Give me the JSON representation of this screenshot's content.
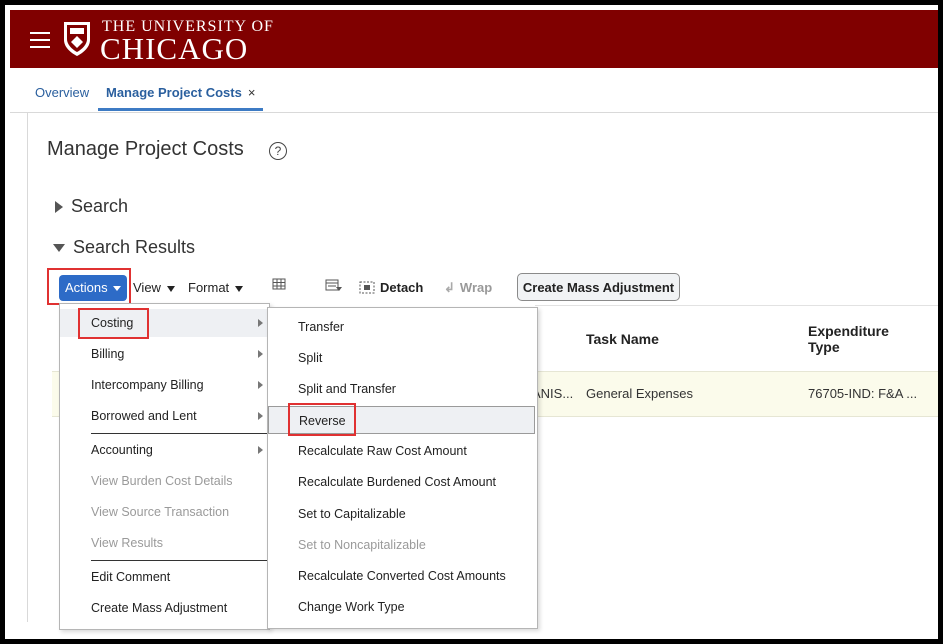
{
  "brand": {
    "top": "THE UNIVERSITY OF",
    "main": "CHICAGO"
  },
  "tabs": {
    "overview": "Overview",
    "active": "Manage Project Costs",
    "close": "×"
  },
  "page": {
    "title": "Manage Project Costs",
    "help": "?"
  },
  "sections": {
    "search": "Search",
    "results": "Search Results"
  },
  "toolbar": {
    "actions": "Actions",
    "view": "View",
    "format": "Format",
    "detach": "Detach",
    "wrap": "Wrap",
    "mass_adjustment": "Create Mass Adjustment"
  },
  "table": {
    "headers": {
      "task_name": "Task Name",
      "exp_type_1": "Expenditure",
      "exp_type_2": "Type"
    },
    "row": {
      "project_frag": "ANIS...",
      "task_name": "General Expenses",
      "exp_type": "76705-IND: F&A ..."
    }
  },
  "actions_menu": [
    {
      "label": "Costing",
      "submenu": true,
      "enabled": true
    },
    {
      "label": "Billing",
      "submenu": true,
      "enabled": true
    },
    {
      "label": "Intercompany Billing",
      "submenu": true,
      "enabled": true
    },
    {
      "label": "Borrowed and Lent",
      "submenu": true,
      "enabled": true
    },
    {
      "label": "Accounting",
      "submenu": true,
      "enabled": true
    },
    {
      "label": "View Burden Cost Details",
      "submenu": false,
      "enabled": false
    },
    {
      "label": "View Source Transaction",
      "submenu": false,
      "enabled": false
    },
    {
      "label": "View Results",
      "submenu": false,
      "enabled": false
    },
    {
      "label": "Edit Comment",
      "submenu": false,
      "enabled": true
    },
    {
      "label": "Create Mass Adjustment",
      "submenu": false,
      "enabled": true
    }
  ],
  "costing_menu": [
    {
      "label": "Transfer",
      "enabled": true
    },
    {
      "label": "Split",
      "enabled": true
    },
    {
      "label": "Split and Transfer",
      "enabled": true
    },
    {
      "label": "Reverse",
      "enabled": true
    },
    {
      "label": "Recalculate Raw Cost Amount",
      "enabled": true
    },
    {
      "label": "Recalculate Burdened Cost Amount",
      "enabled": true
    },
    {
      "label": "Set to Capitalizable",
      "enabled": true
    },
    {
      "label": "Set to Noncapitalizable",
      "enabled": false
    },
    {
      "label": "Recalculate Converted Cost Amounts",
      "enabled": true
    },
    {
      "label": "Change Work Type",
      "enabled": true
    }
  ],
  "colors": {
    "header": "#800000",
    "actions_button": "#2d6bc7",
    "highlight_box": "#e03131",
    "row_bg": "#fbfbeb"
  }
}
